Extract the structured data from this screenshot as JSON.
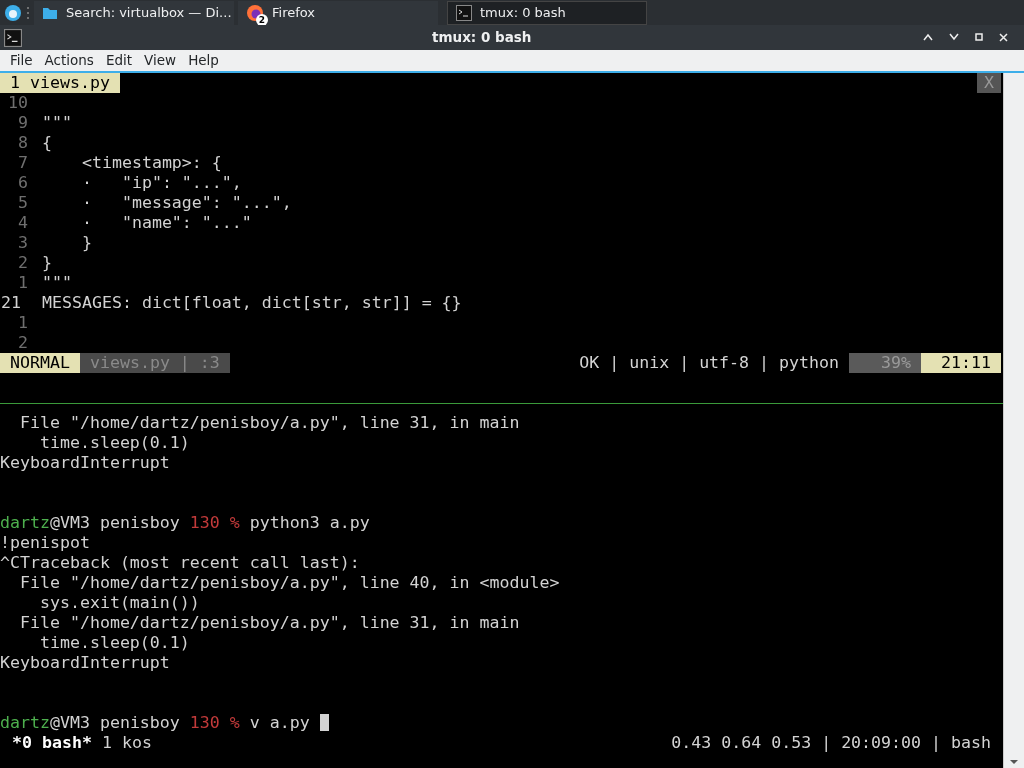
{
  "taskbar": {
    "items": [
      {
        "label": "Search: virtualbox — Di...",
        "kind": "folder",
        "selected": false
      },
      {
        "label": "Firefox",
        "kind": "firefox",
        "badge": "2",
        "selected": false
      },
      {
        "label": "tmux: 0 bash",
        "kind": "terminal",
        "selected": true
      }
    ]
  },
  "window": {
    "title": "tmux: 0 bash"
  },
  "menu": [
    "File",
    "Actions",
    "Edit",
    "View",
    "Help"
  ],
  "editor": {
    "tab": "1 views.py",
    "close": "X",
    "lines": [
      {
        "number": "10",
        "current": false
      },
      {
        "number": "9",
        "text": "\"\"\"",
        "current": false
      },
      {
        "number": "8",
        "text": "{",
        "current": false
      },
      {
        "number": "7",
        "text": "    <timestamp>: {",
        "current": false
      },
      {
        "number": "6",
        "text": "    ·   \"ip\": \"...\",",
        "current": false
      },
      {
        "number": "5",
        "text": "    ·   \"message\": \"...\",",
        "current": false
      },
      {
        "number": "4",
        "text": "    ·   \"name\": \"...\"",
        "current": false
      },
      {
        "number": "3",
        "text": "    }",
        "current": false
      },
      {
        "number": "2",
        "text": "}",
        "current": false
      },
      {
        "number": "1",
        "text": "\"\"\"",
        "current": false
      },
      {
        "number": "21",
        "text": "MESSAGES: dict[float, dict[str, str]] = {}",
        "current": true
      },
      {
        "number": "1",
        "current": false
      },
      {
        "number": "2",
        "current": false
      }
    ],
    "status": {
      "mode": "NORMAL",
      "file": "views.py | :3",
      "info": "OK | unix | utf-8 | python",
      "percent": "39%",
      "position": "21:11"
    }
  },
  "shell": {
    "lines": [
      {
        "kind": "output",
        "text": "  File \"/home/dartz/penisboy/a.py\", line 31, in main"
      },
      {
        "kind": "output",
        "text": "    time.sleep(0.1)"
      },
      {
        "kind": "output",
        "text": "KeyboardInterrupt"
      },
      {
        "kind": "blank"
      },
      {
        "kind": "blank"
      },
      {
        "kind": "prompt",
        "user": "dartz",
        "host": "@VM3 penisboy ",
        "code": "130 %",
        "command": " python3 a.py",
        "cursor": false
      },
      {
        "kind": "output",
        "text": "!penispot"
      },
      {
        "kind": "output",
        "text": "^CTraceback (most recent call last):"
      },
      {
        "kind": "output",
        "text": "  File \"/home/dartz/penisboy/a.py\", line 40, in <module>"
      },
      {
        "kind": "output",
        "text": "    sys.exit(main())"
      },
      {
        "kind": "output",
        "text": "  File \"/home/dartz/penisboy/a.py\", line 31, in main"
      },
      {
        "kind": "output",
        "text": "    time.sleep(0.1)"
      },
      {
        "kind": "output",
        "text": "KeyboardInterrupt"
      },
      {
        "kind": "blank"
      },
      {
        "kind": "blank"
      },
      {
        "kind": "prompt",
        "user": "dartz",
        "host": "@VM3 penisboy ",
        "code": "130 %",
        "command": " v a.py ",
        "cursor": true
      }
    ]
  },
  "tmux_status": {
    "window": "*0 bash*",
    "other": "1 kos",
    "right": "0.43 0.64 0.53 | 20:09:00 | bash"
  }
}
